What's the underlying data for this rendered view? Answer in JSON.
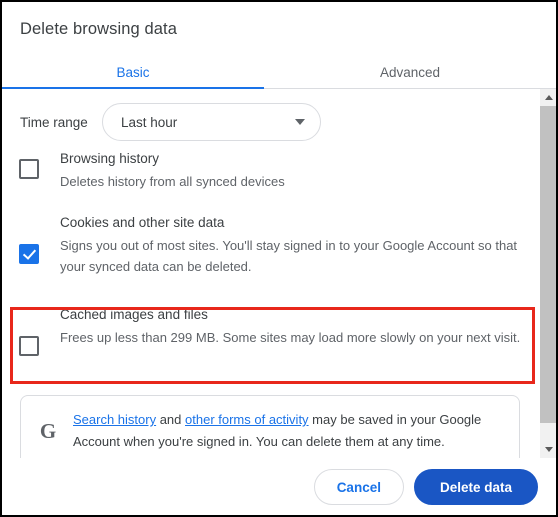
{
  "dialog": {
    "title": "Delete browsing data"
  },
  "tabs": [
    {
      "label": "Basic",
      "active": true
    },
    {
      "label": "Advanced",
      "active": false
    }
  ],
  "time_range": {
    "label": "Time range",
    "selected": "Last hour"
  },
  "options": [
    {
      "name": "browsing-history",
      "title": "Browsing history",
      "description": "Deletes history from all synced devices",
      "checked": false
    },
    {
      "name": "cookies-and-site-data",
      "title": "Cookies and other site data",
      "description": "Signs you out of most sites. You'll stay signed in to your Google Account so that your synced data can be deleted.",
      "checked": true
    },
    {
      "name": "cached-images-and-files",
      "title": "Cached images and files",
      "description": "Frees up less than 299 MB. Some sites may load more slowly on your next visit.",
      "checked": false
    }
  ],
  "info_card": {
    "logo": "G",
    "link1": "Search history",
    "between": " and ",
    "link2": "other forms of activity",
    "tail": " may be saved in your Google Account when you're signed in. You can delete them at any time."
  },
  "footer": {
    "cancel_label": "Cancel",
    "confirm_label": "Delete data"
  },
  "highlight": {
    "color": "#e8271b",
    "target": "cookies-and-site-data"
  },
  "accent_colors": {
    "tab_active": "#1a73e8",
    "checkbox_checked": "#1a73e8",
    "primary_button": "#1a56c4",
    "link": "#1a73e8"
  },
  "scrollbar": {
    "up_arrow": "scroll-up-arrow",
    "down_arrow": "scroll-down-arrow"
  }
}
